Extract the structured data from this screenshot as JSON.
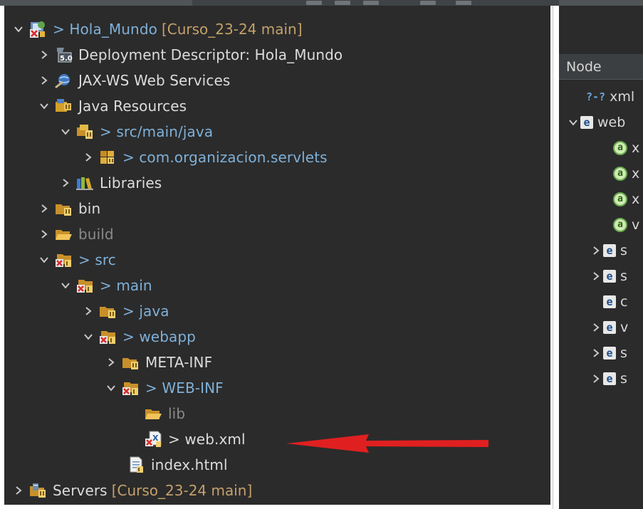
{
  "project_explorer": {
    "items": [
      {
        "label": "Hola_Mundo",
        "prefix": "> ",
        "decoration": "[Curso_23-24 main]",
        "icon": "web-project-error-icon",
        "expanded": true,
        "git_changed": true
      },
      {
        "label": "Deployment Descriptor: Hola_Mundo",
        "icon": "deployment-descriptor-icon",
        "expanded": false
      },
      {
        "label": "JAX-WS Web Services",
        "icon": "web-services-icon",
        "expanded": false
      },
      {
        "label": "Java Resources",
        "icon": "java-resources-icon",
        "expanded": true
      },
      {
        "label": "src/main/java",
        "prefix": "> ",
        "icon": "source-folder-icon",
        "expanded": true,
        "git_changed": true
      },
      {
        "label": "com.organizacion.servlets",
        "prefix": "> ",
        "icon": "package-icon",
        "expanded": false,
        "git_changed": true
      },
      {
        "label": "Libraries",
        "icon": "libraries-icon",
        "expanded": false
      },
      {
        "label": "bin",
        "icon": "folder-icon",
        "expanded": false
      },
      {
        "label": "build",
        "icon": "folder-open-icon",
        "expanded": false,
        "dim": true
      },
      {
        "label": "src",
        "prefix": "> ",
        "icon": "folder-error-icon",
        "expanded": true,
        "git_changed": true
      },
      {
        "label": "main",
        "prefix": "> ",
        "icon": "folder-error-icon",
        "expanded": true,
        "git_changed": true
      },
      {
        "label": "java",
        "prefix": "> ",
        "icon": "folder-icon",
        "expanded": false,
        "git_changed": true
      },
      {
        "label": "webapp",
        "prefix": "> ",
        "icon": "folder-error-icon",
        "expanded": true,
        "git_changed": true
      },
      {
        "label": "META-INF",
        "icon": "folder-icon",
        "expanded": false
      },
      {
        "label": "WEB-INF",
        "prefix": "> ",
        "icon": "folder-error-icon",
        "expanded": true,
        "git_changed": true
      },
      {
        "label": "lib",
        "icon": "folder-open-icon",
        "dim": true
      },
      {
        "label": "web.xml",
        "prefix": "> ",
        "icon": "xml-file-error-icon"
      },
      {
        "label": "index.html",
        "icon": "html-file-icon"
      },
      {
        "label": "Servers",
        "decoration": "[Curso_23-24 main]",
        "icon": "servers-folder-icon",
        "expanded": false
      }
    ]
  },
  "outline": {
    "header": "Node",
    "rows": [
      {
        "kind": "q",
        "text": "xml"
      },
      {
        "kind": "e",
        "text": "web",
        "expanded": true
      },
      {
        "kind": "a",
        "text": "x"
      },
      {
        "kind": "a",
        "text": "x"
      },
      {
        "kind": "a",
        "text": "x"
      },
      {
        "kind": "a",
        "text": "v"
      },
      {
        "kind": "e",
        "text": "s",
        "expanded": false
      },
      {
        "kind": "e",
        "text": "s",
        "expanded": false
      },
      {
        "kind": "e",
        "text": "c"
      },
      {
        "kind": "e",
        "text": "v",
        "expanded": false
      },
      {
        "kind": "e",
        "text": "s",
        "expanded": false
      },
      {
        "kind": "e",
        "text": "s",
        "expanded": false
      }
    ]
  },
  "colors": {
    "background": "#2b2b2b",
    "text": "#dcdcdc",
    "git_decoration": "#c4a16b",
    "git_changed_text": "#7fb0d8",
    "annotation_arrow": "#e02020"
  }
}
